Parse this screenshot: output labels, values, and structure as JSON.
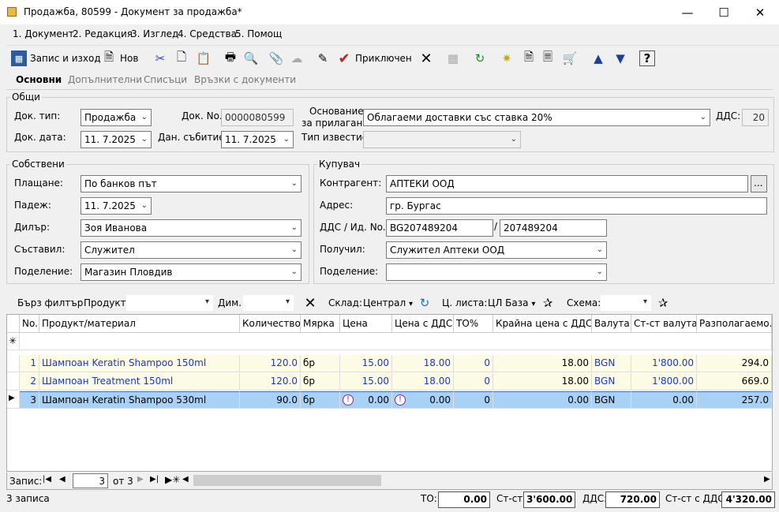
{
  "window": {
    "title": "Продажба, 80599 - Документ за продажба*"
  },
  "menu": [
    "1. Документ",
    "2. Редакция",
    "3. Изглед",
    "4. Средства",
    "5. Помощ"
  ],
  "toolbar": {
    "save_exit": "Запис и изход",
    "new": "Нов",
    "finished": "Приключен"
  },
  "tabs": [
    "Основни",
    "Допълнителни",
    "Списъци",
    "Връзки с документи"
  ],
  "general": {
    "group": "Общи",
    "doc_type_label": "Док. тип:",
    "doc_type": "Продажба",
    "doc_no_label": "Док. No.",
    "doc_no": "0000080599",
    "basis_label_1": "Основание",
    "basis_label_2": "за прилагане:",
    "basis": "Облагаеми доставки със ставка 20%",
    "vat_label": "ДДС:",
    "vat": "20",
    "doc_date_label": "Док. дата:",
    "doc_date": "11. 7.2025",
    "tax_event_label": "Дан. събитие:",
    "tax_event": "11. 7.2025",
    "notice_type_label": "Тип известие:",
    "notice_type": ""
  },
  "own": {
    "group": "Собствени",
    "payment_label": "Плащане:",
    "payment": "По банков път",
    "due_label": "Падеж:",
    "due": "11. 7.2025",
    "dealer_label": "Дилър:",
    "dealer": "Зоя Иванова",
    "composer_label": "Съставил:",
    "composer": "Служител",
    "division_label": "Поделение:",
    "division": "Магазин Пловдив"
  },
  "buyer": {
    "group": "Купувач",
    "contractor_label": "Контрагент:",
    "contractor": "АПТЕКИ ООД",
    "browse": "...",
    "address_label": "Адрес:",
    "address": "гр. Бургас",
    "vat_id_label": "ДДС / Ид. No.",
    "vat_no": "BG207489204",
    "sep": "/",
    "id_no": "207489204",
    "received_label": "Получил:",
    "received": "Служител Аптеки ООД",
    "division_label": "Поделение:",
    "division": ""
  },
  "filter": {
    "quick": "Бърз филтър",
    "product_label": "Продукт:",
    "dim_label": "Дим.",
    "warehouse_label": "Склад:",
    "warehouse": "Централ",
    "pricelist_label": "Ц. листа:",
    "pricelist": "ЦЛ База",
    "scheme_label": "Схема:"
  },
  "grid": {
    "headers": [
      "No.",
      "Продукт/материал",
      "Количество",
      "Мярка",
      "Цена",
      "Цена с ДДС",
      "ТО%",
      "Крайна цена с ДДС",
      "Валута",
      "Ст-ст валута",
      "Разполагаемо..."
    ],
    "new_row_marker": "✳",
    "rows": [
      [
        "1",
        "Шампоан Keratin Shampoo 150ml",
        "120.0",
        "бр",
        "15.00",
        "18.00",
        "0",
        "18.00",
        "BGN",
        "1'800.00",
        "294.0"
      ],
      [
        "2",
        "Шампоан Treatment 150ml",
        "120.0",
        "бр",
        "15.00",
        "18.00",
        "0",
        "18.00",
        "BGN",
        "1'800.00",
        "669.0"
      ],
      [
        "3",
        "Шампоан Keratin Shampoo 530ml",
        "90.0",
        "бр",
        "0.00",
        "0.00",
        "0",
        "0.00",
        "BGN",
        "0.00",
        "257.0"
      ]
    ]
  },
  "nav": {
    "label": "Запис:",
    "current": "3",
    "of": "от 3"
  },
  "status": {
    "records": "3 записа",
    "to_label": "ТО:",
    "to": "0.00",
    "cost_label": "Ст-ст:",
    "cost": "3'600.00",
    "vat_label": "ДДС:",
    "vat": "720.00",
    "cost_vat_label": "Ст-ст с ДДС:",
    "cost_vat": "4'320.00"
  }
}
